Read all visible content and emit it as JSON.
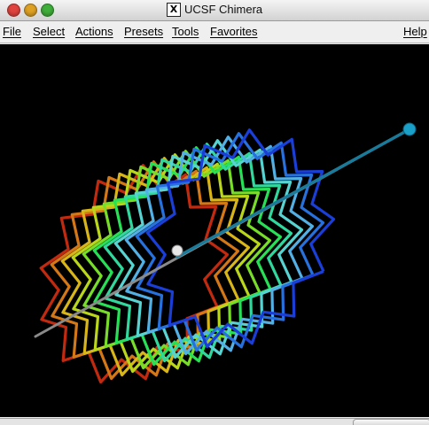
{
  "window": {
    "title": "UCSF Chimera",
    "x11_badge": "X"
  },
  "menubar": {
    "items": [
      "File",
      "Select",
      "Actions",
      "Presets",
      "Tools",
      "Favorites"
    ],
    "help": "Help"
  },
  "status": {
    "message": "",
    "button": ""
  },
  "colors": {
    "background": "#000000",
    "axis": "#888888",
    "axis_tip": "#1a8fb0",
    "ribbon_gradient": [
      "#1a3fd8",
      "#2a7ee0",
      "#6fd2e8",
      "#33d6b0",
      "#27e055",
      "#8cdc1e",
      "#d8d218",
      "#d88a18",
      "#c22a10"
    ]
  },
  "icons": {
    "close": "close-button-icon",
    "minimize": "minimize-button-icon",
    "zoom": "zoom-button-icon"
  }
}
